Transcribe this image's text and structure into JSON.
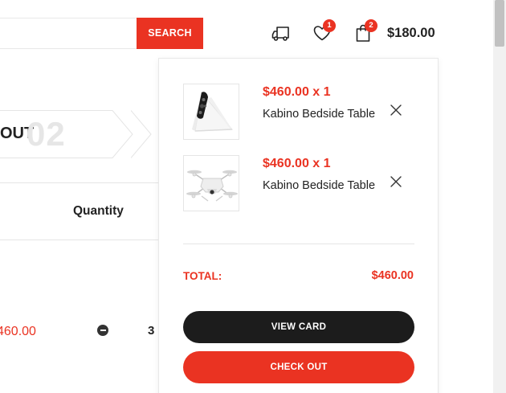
{
  "search": {
    "placeholder": "",
    "value": "",
    "button_label": "SEARCH"
  },
  "header": {
    "icons": {
      "shipping": "truck-icon",
      "wishlist": "heart-icon",
      "cart": "shopping-bag-icon"
    },
    "wishlist_count": "1",
    "cart_count": "2",
    "cart_total": "$180.00"
  },
  "checkout_steps": {
    "label": "OUT",
    "number": "02"
  },
  "cart_table": {
    "quantity_header": "Quantity",
    "row_price": "460.00",
    "row_quantity": "3"
  },
  "mini_cart": {
    "items": [
      {
        "price": "$460.00 x 1",
        "name": "Kabino Bedside Table",
        "image": "smart-speaker-image",
        "remove_icon": "close-icon"
      },
      {
        "price": "$460.00 x 1",
        "name": "Kabino Bedside Table",
        "image": "drone-image",
        "remove_icon": "close-icon"
      }
    ],
    "total_label": "TOTAL:",
    "total_value": "$460.00",
    "view_button": "VIEW CARD",
    "checkout_button": "CHECK OUT"
  },
  "colors": {
    "accent": "#ea3322",
    "dark_button": "#1c1c1c",
    "text": "#222222",
    "muted_number": "#e6e6e6"
  }
}
